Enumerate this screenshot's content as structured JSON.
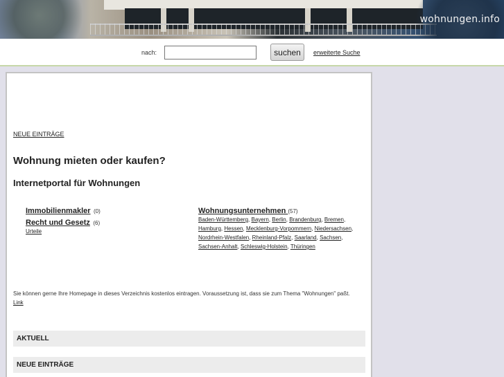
{
  "header": {
    "brand": "wohnungen.info"
  },
  "search": {
    "label": "nach:",
    "value": "",
    "button": "suchen",
    "advanced_link": "erweiterte Suche"
  },
  "main": {
    "new_entries_link": "NEUE EINTRÄGE",
    "title": "Wohnung mieten oder kaufen?",
    "subtitle": "Internetportal für Wohnungen",
    "categories_left": [
      {
        "name": "Immobilienmakler",
        "count": "(0)"
      },
      {
        "name": "Recht und Gesetz",
        "count": "(6)",
        "subs": [
          "Urteile"
        ]
      }
    ],
    "categories_right": [
      {
        "name": "Wohnungsunternehmen ",
        "count": "(57)",
        "subs": [
          "Baden-Württemberg",
          "Bayern",
          "Berlin",
          "Brandenburg",
          "Bremen",
          "Hamburg",
          "Hessen",
          "Mecklenburg-Vorpommern",
          "Niedersachsen",
          "Nordrhein-Westfalen",
          "Rheinland-Pfalz",
          "Saarland",
          "Sachsen",
          "Sachsen-Anhalt",
          "Schleswig-Holstein",
          "Thüringen"
        ]
      }
    ],
    "info_text": "Sie können gerne Ihre Homepage in dieses Verzeichnis kostenlos eintragen. Voraussetzung ist, dass sie zum Thema \"Wohnungen\" paßt.",
    "info_link": "Link",
    "sections": [
      "AKTUELL",
      "NEUE EINTRÄGE"
    ]
  }
}
